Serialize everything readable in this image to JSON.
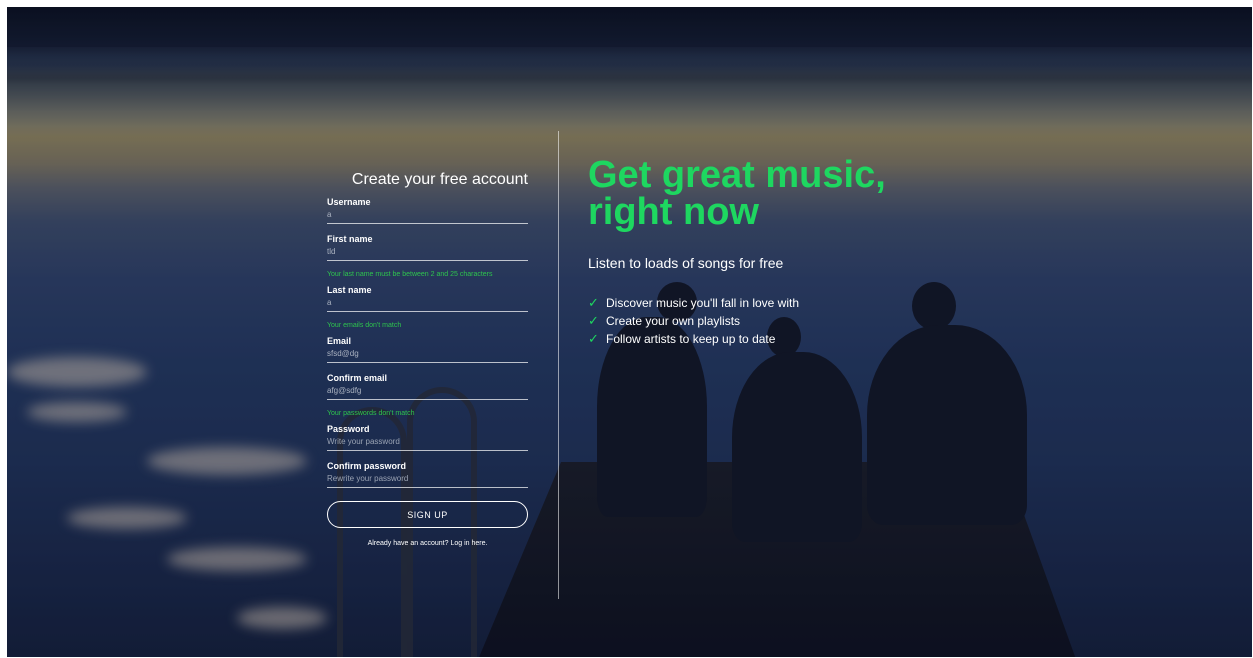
{
  "form": {
    "title": "Create your free account",
    "fields": {
      "username": {
        "label": "Username",
        "value": "a"
      },
      "first_name": {
        "label": "First name",
        "value": "tld"
      },
      "last_name": {
        "label": "Last name",
        "value": "a"
      },
      "email": {
        "label": "Email",
        "value": "sfsd@dg"
      },
      "confirm_email": {
        "label": "Confirm email",
        "value": "afg@sdfg"
      },
      "password": {
        "label": "Password",
        "placeholder": "Write your password"
      },
      "confirm_password": {
        "label": "Confirm password",
        "placeholder": "Rewrite your password"
      }
    },
    "errors": {
      "last_name": "Your last name must be between 2 and 25 characters",
      "email": "Your emails don't match",
      "password": "Your passwords don't match"
    },
    "signup_label": "SIGN UP",
    "login_prompt": "Already have an account? Log in here."
  },
  "promo": {
    "headline_line1": "Get great music,",
    "headline_line2": "right now",
    "subhead": "Listen to loads of songs for free",
    "features": [
      "Discover music you'll fall in love with",
      "Create your own playlists",
      "Follow artists to keep up to date"
    ]
  },
  "colors": {
    "accent": "#1ed760",
    "error": "#2ec44e",
    "text": "#ffffff"
  },
  "icons": {
    "feature_bullet": "check-icon"
  }
}
